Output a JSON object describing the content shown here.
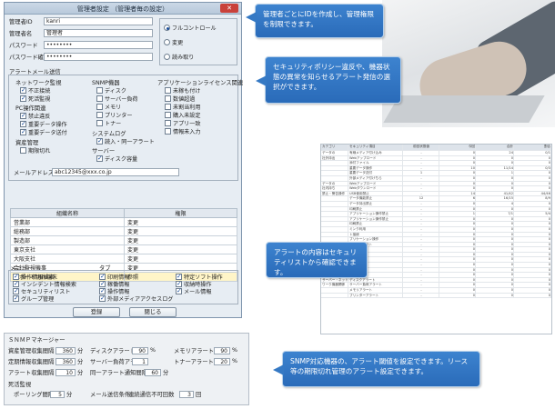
{
  "window": {
    "title": "管理者設定 （管理者毎の設定）",
    "close_label": "✕"
  },
  "admin": {
    "id_label": "管理者ID",
    "id_value": "kanri",
    "name_label": "管理者名",
    "name_value": "管理者",
    "pw_label": "パスワード",
    "pw_value": "••••••••",
    "pw_confirm_label": "パスワード確認",
    "pw_confirm_value": "••••••••"
  },
  "permission": {
    "options": [
      "フルコントロール",
      "変更",
      "読み取り"
    ],
    "selected": 0
  },
  "alert_mail": {
    "title": "アラートメール送信",
    "network": {
      "title": "ネットワーク監視",
      "items": [
        {
          "label": "不正接続",
          "checked": true
        },
        {
          "label": "死活監視",
          "checked": true
        }
      ]
    },
    "pc_ops": {
      "title": "PC操作関連",
      "items": [
        {
          "label": "禁止違反",
          "checked": true
        },
        {
          "label": "重要データ操作",
          "checked": true
        },
        {
          "label": "重要データ送付",
          "checked": true
        }
      ]
    },
    "asset": {
      "title": "資産管理",
      "items": [
        {
          "label": "期限切れ",
          "checked": false
        }
      ]
    },
    "snmp": {
      "title": "SNMP機器",
      "items": [
        {
          "label": "ディスク",
          "checked": false
        },
        {
          "label": "サーバー負荷",
          "checked": false
        },
        {
          "label": "メモリ",
          "checked": false
        },
        {
          "label": "プリンター",
          "checked": false
        },
        {
          "label": "トナー",
          "checked": false
        }
      ]
    },
    "syslog": {
      "title": "システムログ",
      "items": [
        {
          "label": "読入・同一アラート",
          "checked": true
        }
      ]
    },
    "server": {
      "title": "サーバー",
      "items": [
        {
          "label": "ディスク容量",
          "checked": true
        }
      ]
    },
    "app_license": {
      "title": "アプリケーションライセンス関連",
      "items": [
        {
          "label": "未稼も付け",
          "checked": false
        },
        {
          "label": "数値超過",
          "checked": false
        },
        {
          "label": "未割当利用",
          "checked": false
        },
        {
          "label": "購入未設定",
          "checked": false
        },
        {
          "label": "アプリ一致",
          "checked": false
        },
        {
          "label": "情報未入力",
          "checked": false
        }
      ]
    },
    "mail_label": "メールアドレス",
    "mail_value": "abc12345@xxx.co.jp"
  },
  "org_table": {
    "headers": [
      "組織名称",
      "権限"
    ],
    "rows": [
      [
        "営業部",
        "変更"
      ],
      [
        "総務部",
        "変更"
      ],
      [
        "製造部",
        "変更"
      ],
      [
        "東京支社",
        "変更"
      ],
      [
        "大阪支社",
        "変更"
      ],
      [
        "会社監視機事",
        "変更"
      ],
      [
        "サポート切れ端末",
        "参照"
      ]
    ],
    "selected_row": 6
  },
  "menu": {
    "title": "メニュー",
    "items": [
      {
        "label": "操作情報検索",
        "checked": true
      },
      {
        "label": "インシデント情報検索",
        "checked": true
      },
      {
        "label": "セキュリティリスト",
        "checked": true
      },
      {
        "label": "グループ管理",
        "checked": true
      }
    ]
  },
  "tabs": {
    "title": "タブ",
    "col1": [
      {
        "label": "印刷情報",
        "checked": true
      },
      {
        "label": "稼働情報",
        "checked": true
      },
      {
        "label": "操作情報",
        "checked": true
      },
      {
        "label": "外部メディアアクセスログ",
        "checked": true
      }
    ],
    "col2": [
      {
        "label": "特定ソフト操作",
        "checked": true
      },
      {
        "label": "収納時操作",
        "checked": true
      },
      {
        "label": "メール情報",
        "checked": true
      }
    ]
  },
  "buttons": {
    "register": "登録",
    "close": "閉じる"
  },
  "snmp_manager": {
    "title": "ＳＮＭＰマネージャー",
    "rows": [
      {
        "label": "資産管理収集間隔",
        "value": "360",
        "unit": "分"
      },
      {
        "label": "定期情報収集間隔",
        "value": "360",
        "unit": "分"
      },
      {
        "label": "アラート収集間隔",
        "value": "10",
        "unit": "分"
      }
    ],
    "disk_label": "ディスクアラート",
    "disk_value": "90",
    "disk_unit": "%",
    "server_label": "サーバー負荷アラート",
    "server_value": "1",
    "interval_label": "同一アラート通知間隔",
    "interval_value": "60",
    "interval_unit": "分",
    "memory_label": "メモリアラート",
    "memory_value": "90",
    "memory_unit": "%",
    "toner_label": "トナーアラート",
    "toner_value": "20",
    "toner_unit": "%",
    "polling_section": "死活監視",
    "polling_label": "ポーリング間隔",
    "polling_value": "5",
    "polling_unit": "分",
    "mail_cond_label": "メール送信条件",
    "fail_label": "連続通信不可回数",
    "fail_value": "3",
    "fail_unit": "回"
  },
  "callouts": [
    "管理者ごとにIDを作成し、管理権限を制限できます。",
    "セキュリティポリシー違反や、機器状態の異常を知らせるアラート発信の選択ができます。",
    "アラートの内容はセキュリティリストから確認できます。",
    "SNMP対応機器の、アラート閾値を設定できます。リース等の期限切れ管理のアラート設定できます。"
  ],
  "report": {
    "headers": [
      "カテゴリ",
      "セキュリティ項目",
      "前回状態値",
      "今回",
      "合計",
      "割合"
    ],
    "categories": [
      "データの社外持出",
      "データの社内持ち出し",
      "禁止・警告操作",
      "不明作業",
      "サーバー・ネットワーク機器関係"
    ],
    "rows": [
      [
        "データの",
        "有線メディア付け込み",
        "-",
        "0",
        "24",
        "0/1"
      ],
      [
        "社外持出",
        "Webアップロード",
        "-",
        "0",
        "0",
        "0"
      ],
      [
        "",
        "添付ファイル",
        "-",
        "0",
        "0",
        "0"
      ],
      [
        "",
        "重要データ操作",
        "-",
        "10",
        "11/14",
        "0/3"
      ],
      [
        "",
        "重要データ送付",
        "1",
        "0",
        "1",
        "0"
      ],
      [
        "",
        "外部メディア付けちら",
        "-",
        "0",
        "0",
        "0"
      ],
      [
        "データの",
        "Webアップロード",
        "-",
        "0",
        "0",
        "0"
      ],
      [
        "社内持ち",
        "Webダウンロード",
        "-",
        "0",
        "0",
        "0"
      ],
      [
        "禁止・警告操作",
        "USB使用禁止",
        "-",
        "14",
        "41/42",
        "44/46"
      ],
      [
        "",
        "データ機能禁止",
        "12",
        "6",
        "16/15",
        "8/9"
      ],
      [
        "",
        "データ持出禁止",
        "-",
        "0",
        "4",
        "0"
      ],
      [
        "",
        "印刷禁止",
        "-",
        "0",
        "0",
        "0"
      ],
      [
        "",
        "アプリケーション操作禁止",
        "-",
        "1",
        "7/1",
        "5/4"
      ],
      [
        "",
        "アプリケーション操作禁止",
        "-",
        "0",
        "0",
        "0"
      ],
      [
        "",
        "印刷禁止",
        "-",
        "0",
        "0",
        "0"
      ],
      [
        "",
        "ミンク利用",
        "-",
        "0",
        "0",
        "0"
      ],
      [
        "",
        "ト接続",
        "-",
        "0",
        "0",
        "0"
      ],
      [
        "",
        "プリケーション操作",
        "-",
        "0",
        "0",
        "0"
      ],
      [
        "",
        "チンパーセフト",
        "-",
        "0",
        "0",
        "0"
      ],
      [
        "不明作業",
        "ーソ実行",
        "-",
        "0",
        "0",
        "0"
      ],
      [
        "",
        "作業",
        "-",
        "0",
        "0",
        "0"
      ],
      [
        "",
        "入",
        "-",
        "0",
        "0",
        "0"
      ],
      [
        "",
        "ーバー",
        "-",
        "0",
        "0",
        "0"
      ],
      [
        "",
        "ンタ",
        "-",
        "0",
        "0",
        "0"
      ],
      [
        "",
        "その他作業",
        "-",
        "0",
        "0",
        "0"
      ],
      [
        "サーバー・ネット",
        "ディスクアラート",
        "-",
        "0",
        "0",
        "0"
      ],
      [
        "ワーク機器関係",
        "サーバー負荷アラート",
        "-",
        "0",
        "0",
        "0"
      ],
      [
        "",
        "メモリアラート",
        "-",
        "0",
        "0",
        "0"
      ],
      [
        "",
        "プリンターアラート",
        "-",
        "0",
        "0",
        "0"
      ]
    ]
  },
  "colors": {
    "callout_bg": "#3279c6",
    "window_bg": "#e7edf3",
    "selected_row": "#fff5c8"
  }
}
